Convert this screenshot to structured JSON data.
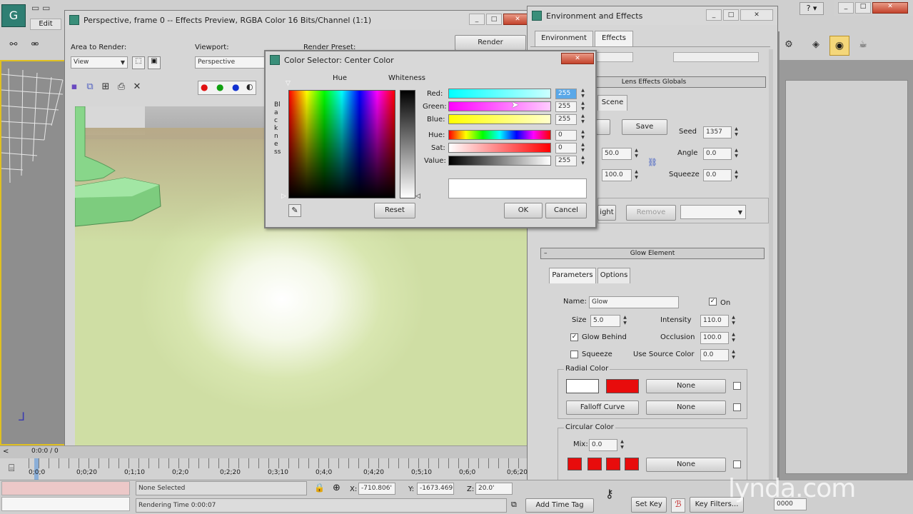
{
  "app": {
    "menu_edit": "Edit"
  },
  "preview": {
    "title": "Perspective, frame 0 -- Effects Preview, RGBA Color 16 Bits/Channel (1:1)",
    "area_label": "Area to Render:",
    "area_value": "View",
    "viewport_label": "Viewport:",
    "viewport_value": "Perspective",
    "preset_label": "Render Preset:",
    "render_button": "Render",
    "channel_red": "●",
    "channel_green": "●",
    "channel_blue": "●",
    "channel_alpha": "◐"
  },
  "env": {
    "title": "Environment and Effects",
    "tab_environment": "Environment",
    "tab_effects": "Effects",
    "lens_globals_header": "Lens Effects Globals",
    "tab_scene": "Scene",
    "save_button": "Save",
    "seed_label": "Seed",
    "seed_value": "1357",
    "angle_label": "Angle",
    "angle_value": "0.0",
    "squeeze_label": "Squeeze",
    "squeeze_value": "0.0",
    "size_value_a": "50.0",
    "size_value_b": "100.0",
    "light_button": "ight",
    "remove_button": "Remove",
    "glow_header": "Glow Element",
    "tab_parameters": "Parameters",
    "tab_options": "Options",
    "name_label": "Name:",
    "name_value": "Glow",
    "on_label": "On",
    "size_label": "Size",
    "size_value": "5.0",
    "intensity_label": "Intensity",
    "intensity_value": "110.0",
    "glow_behind_label": "Glow Behind",
    "occlusion_label": "Occlusion",
    "occlusion_value": "100.0",
    "squeeze_check_label": "Squeeze",
    "use_source_label": "Use Source Color",
    "use_source_value": "0.0",
    "radial_color_label": "Radial Color",
    "none_1": "None",
    "falloff_button": "Falloff Curve",
    "none_2": "None",
    "circular_color_label": "Circular Color",
    "mix_label": "Mix:",
    "mix_value": "0.0",
    "none_3": "None"
  },
  "color_selector": {
    "title": "Color Selector: Center Color",
    "hue_label": "Hue",
    "whiteness_label": "Whiteness",
    "blackness_label": "Blackness",
    "red_label": "Red:",
    "red_value": "255",
    "green_label": "Green:",
    "green_value": "255",
    "blue_label": "Blue:",
    "blue_value": "255",
    "hue2_label": "Hue:",
    "hue_value": "0",
    "sat_label": "Sat:",
    "sat_value": "0",
    "value_label": "Value:",
    "value_value": "255",
    "reset_button": "Reset",
    "ok_button": "OK",
    "cancel_button": "Cancel"
  },
  "timeline": {
    "current": "0:0:0 / 0",
    "ticks": [
      "0;0;0",
      "0;0;20",
      "0;1;10",
      "0;2;0",
      "0;2;20",
      "0;3;10",
      "0;4;0",
      "0;4;20",
      "0;5;10",
      "0;6;0",
      "0;6;20"
    ]
  },
  "status": {
    "selection": "None Selected",
    "rendering_time": "Rendering Time  0:00:07",
    "x_label": "X:",
    "x_value": "-710.806'",
    "y_label": "Y:",
    "y_value": "-1673.469'",
    "z_label": "Z:",
    "z_value": "20.0'",
    "add_time_tag": "Add Time Tag",
    "set_key": "Set Key",
    "key_filters": "Key Filters...",
    "frame_value": "0000"
  },
  "watermark": "lynda.com"
}
